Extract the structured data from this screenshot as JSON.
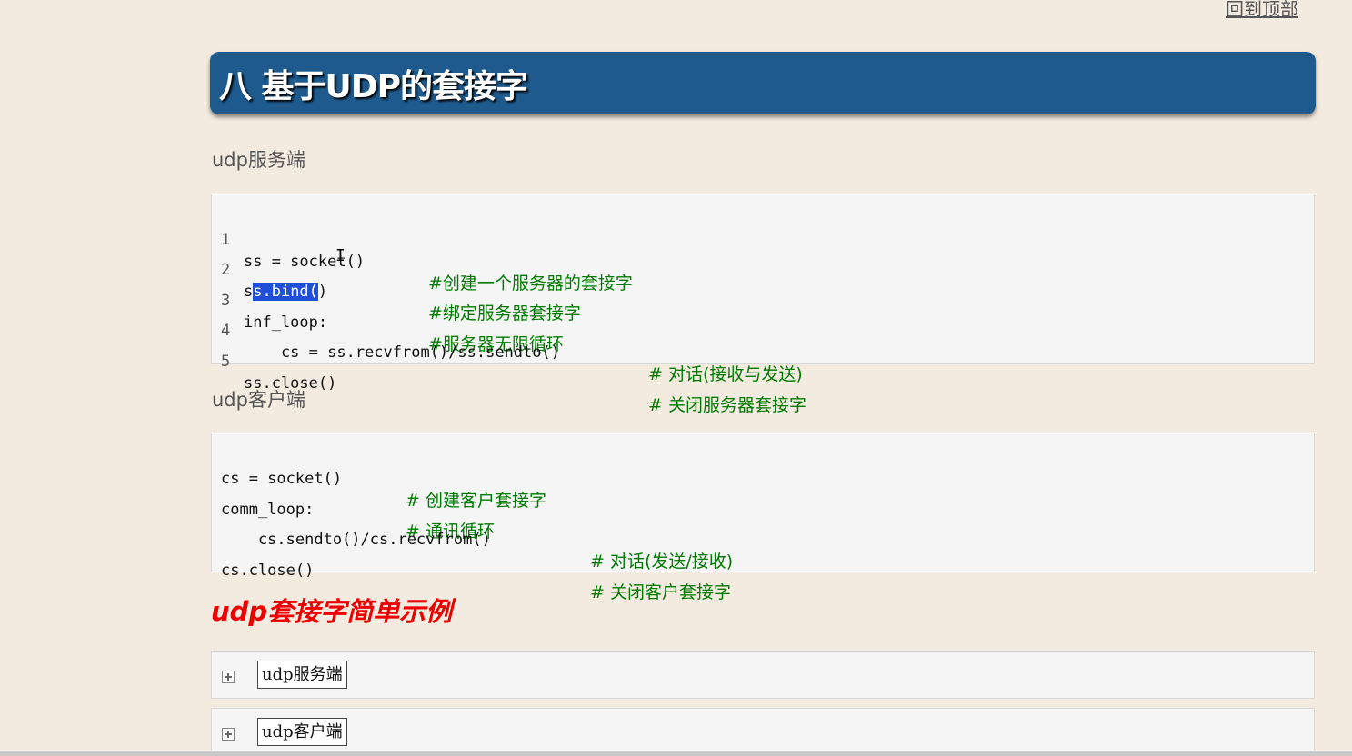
{
  "nav": {
    "back_to_top": "回到顶部"
  },
  "heading": {
    "title": "八 基于UDP的套接字"
  },
  "server": {
    "label": "udp服务端",
    "lines": [
      {
        "no": "1",
        "code": "ss = socket()",
        "comment": "#创建一个服务器的套接字"
      },
      {
        "no": "2",
        "code_pre": "s",
        "code_sel": "s.bind(",
        "code_post": ")",
        "comment": "#绑定服务器套接字"
      },
      {
        "no": "3",
        "code": "inf_loop:",
        "comment": "#服务器无限循环"
      },
      {
        "no": "4",
        "code": "    cs = ss.recvfrom()/ss.sendto()",
        "comment": "# 对话(接收与发送)"
      },
      {
        "no": "5",
        "code": "ss.close()",
        "comment": "# 关闭服务器套接字"
      }
    ]
  },
  "client": {
    "label": "udp客户端",
    "lines": [
      {
        "code": "cs = socket()",
        "comment": "# 创建客户套接字"
      },
      {
        "code": "comm_loop:",
        "comment": "# 通讯循环"
      },
      {
        "code": "    cs.sendto()/cs.recvfrom()",
        "comment": "# 对话(发送/接收)"
      },
      {
        "code": "cs.close()",
        "comment": "# 关闭客户套接字"
      }
    ]
  },
  "example": {
    "title": "udp套接字简单示例",
    "blocks": [
      {
        "label": "udp服务端"
      },
      {
        "label": "udp客户端"
      }
    ]
  }
}
